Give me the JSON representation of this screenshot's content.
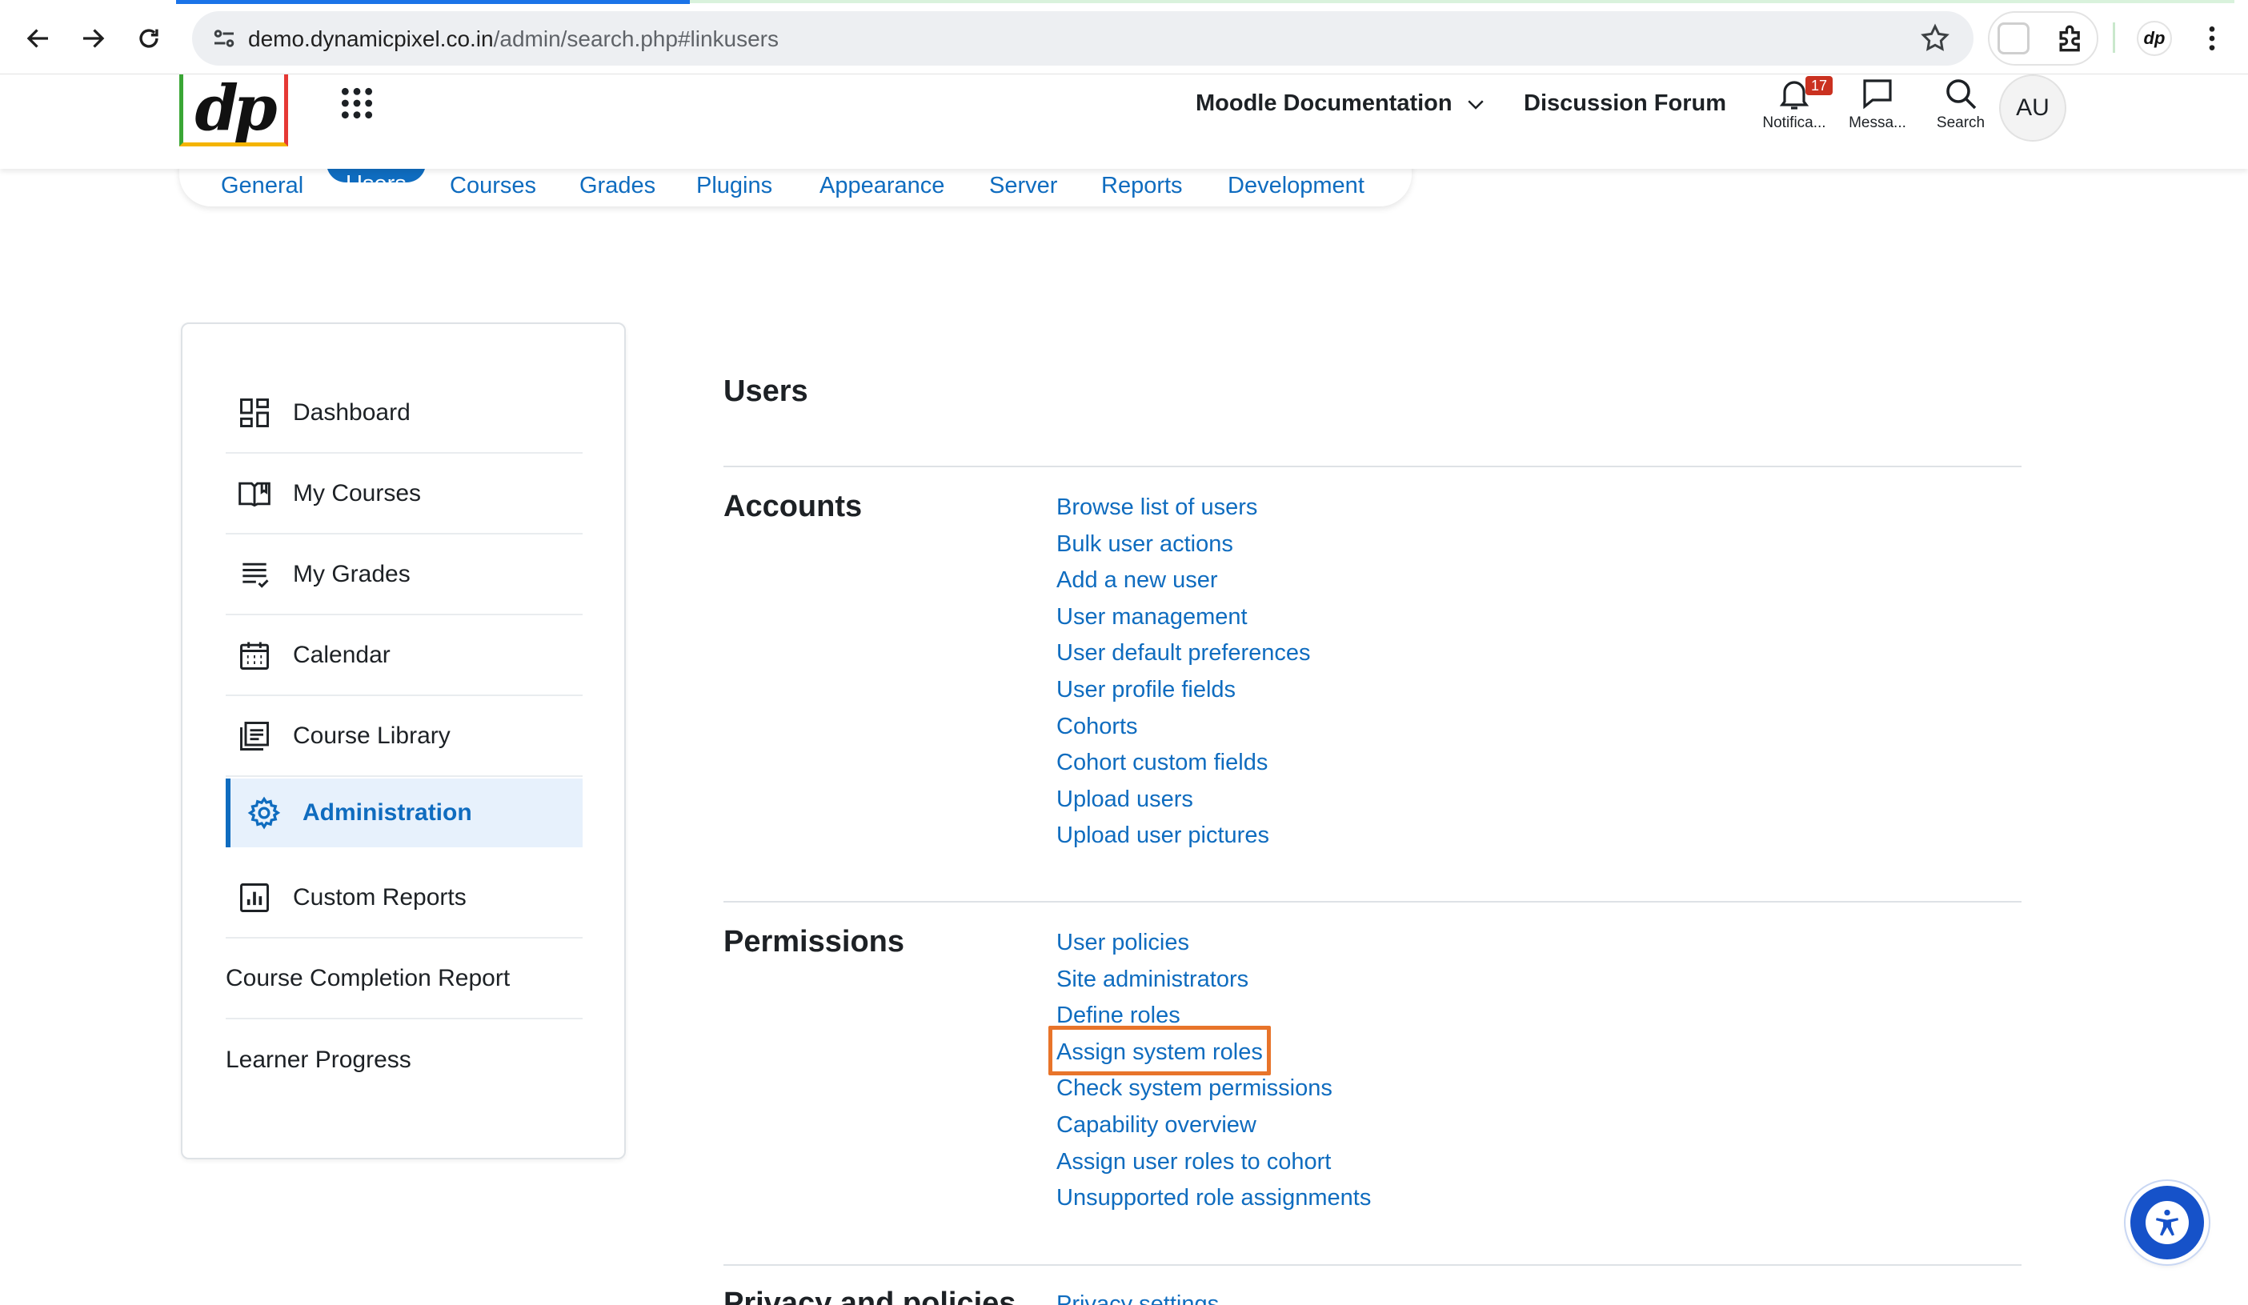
{
  "browser": {
    "url_domain": "demo.dynamicpixel.co.in",
    "url_path": "/admin/search.php#linkusers",
    "profile_initials": "dp"
  },
  "header": {
    "logo_text": "dp",
    "nav": [
      {
        "label": "Moodle Documentation"
      },
      {
        "label": "Discussion Forum"
      }
    ],
    "notifications_label": "Notifica...",
    "notifications_count": "17",
    "messages_label": "Messa...",
    "search_label": "Search",
    "avatar_initials": "AU"
  },
  "tabs": [
    {
      "label": "General"
    },
    {
      "label": "Users",
      "active": true
    },
    {
      "label": "Courses"
    },
    {
      "label": "Grades"
    },
    {
      "label": "Plugins"
    },
    {
      "label": "Appearance"
    },
    {
      "label": "Server"
    },
    {
      "label": "Reports"
    },
    {
      "label": "Development"
    }
  ],
  "sidebar": {
    "items": [
      {
        "label": "Dashboard",
        "icon": "dashboard-icon"
      },
      {
        "label": "My Courses",
        "icon": "book-open-icon"
      },
      {
        "label": "My Grades",
        "icon": "grades-list-icon"
      },
      {
        "label": "Calendar",
        "icon": "calendar-icon"
      },
      {
        "label": "Course Library",
        "icon": "library-icon"
      },
      {
        "label": "Administration",
        "icon": "gear-icon",
        "active": true
      },
      {
        "label": "Custom Reports",
        "icon": "report-chart-icon"
      },
      {
        "label": "Course Completion Report"
      },
      {
        "label": "Learner Progress"
      }
    ]
  },
  "main": {
    "title": "Users",
    "sections": [
      {
        "title": "Accounts",
        "links": [
          "Browse list of users",
          "Bulk user actions",
          "Add a new user",
          "User management",
          "User default preferences",
          "User profile fields",
          "Cohorts",
          "Cohort custom fields",
          "Upload users",
          "Upload user pictures"
        ]
      },
      {
        "title": "Permissions",
        "links": [
          "User policies",
          "Site administrators",
          "Define roles",
          "Assign system roles",
          "Check system permissions",
          "Capability overview",
          "Assign user roles to cohort",
          "Unsupported role assignments"
        ]
      },
      {
        "title": "Privacy and policies",
        "links": [
          "Privacy settings"
        ]
      }
    ],
    "highlighted_link": "Assign system roles"
  },
  "colors": {
    "link": "#0f6cbf",
    "highlight": "#e8742a",
    "active_bg": "#e7f1fc",
    "badge": "#ca3120",
    "a11y_button": "#1652c9"
  }
}
